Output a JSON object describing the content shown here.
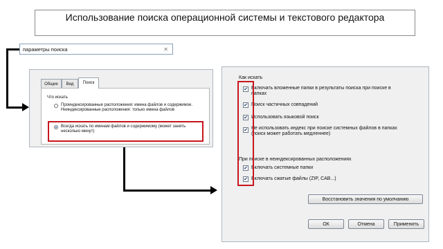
{
  "title": "Использование поиска операционной системы и текстового редактора",
  "search": {
    "value": "параметры поиска",
    "clear_symbol": "✕"
  },
  "panel1": {
    "tabs": [
      "Общие",
      "Вид",
      "Поиск"
    ],
    "section": "Что искать",
    "option1": "Проиндексированные расположения: имена файлов и содержимое. Неиндексированные расположения: только имена файлов",
    "option2": "Всегда искать по именам файлов и содержимому (может занять несколько минут)",
    "selected": 2
  },
  "panel2": {
    "section1": "Как искать",
    "options1": [
      {
        "label": "Включать вложенные папки в результаты поиска при поиске в папках",
        "checked": true
      },
      {
        "label": "Поиск частичных совпадений",
        "checked": true
      },
      {
        "label": "Использовать языковой поиск",
        "checked": true
      },
      {
        "label": "Не использовать индекс при поиске системных файлов в папках (поиск может работать медленнее)",
        "checked": true
      }
    ],
    "section2": "При поиске в неиндексированных расположениях",
    "options2": [
      {
        "label": "Включать системные папки",
        "checked": true
      },
      {
        "label": "Включать сжатые файлы (ZIP, CAB...)",
        "checked": true
      }
    ],
    "restore_button": "Восстановить значения по умолчанию",
    "ok_button": "ОК",
    "cancel_button": "Отмена",
    "apply_button": "Применить"
  },
  "colors": {
    "highlight": "#c8151c",
    "check": "#1f3c70",
    "radio": "#1a5fb4"
  }
}
